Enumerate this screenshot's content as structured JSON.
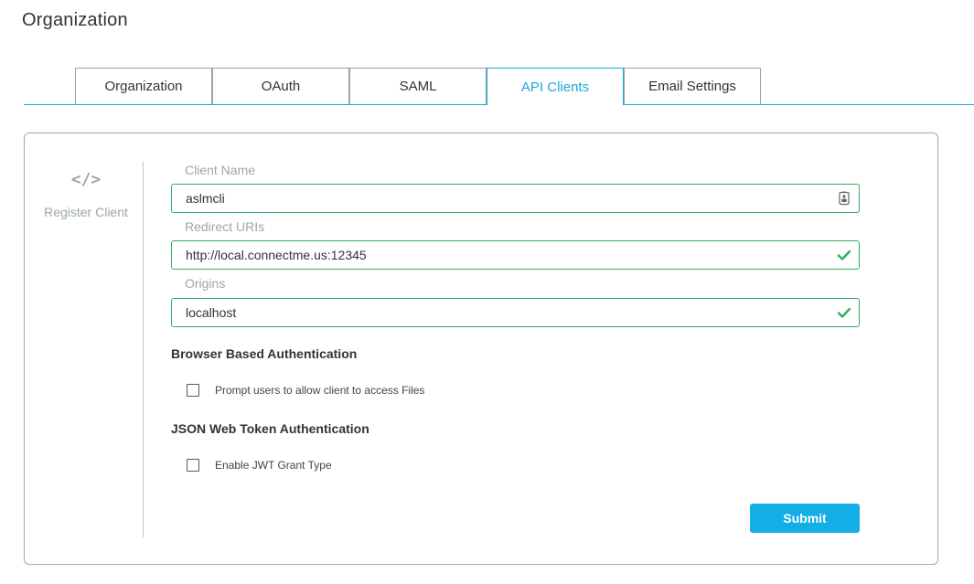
{
  "page": {
    "title": "Organization"
  },
  "tabs": [
    {
      "label": "Organization",
      "active": false
    },
    {
      "label": "OAuth",
      "active": false
    },
    {
      "label": "SAML",
      "active": false
    },
    {
      "label": "API Clients",
      "active": true
    },
    {
      "label": "Email Settings",
      "active": false
    }
  ],
  "sidebar": {
    "icon_glyph": "</>",
    "icon_name": "code-icon",
    "label": "Register Client"
  },
  "form": {
    "client_name": {
      "label": "Client Name",
      "value": "aslmcli",
      "icon": "contact-card-icon"
    },
    "redirect_uris": {
      "label": "Redirect URIs",
      "value": "http://local.connectme.us:12345",
      "icon": "checkmark-icon"
    },
    "origins": {
      "label": "Origins",
      "value": "localhost",
      "icon": "checkmark-icon"
    },
    "browser_auth": {
      "heading": "Browser Based Authentication",
      "checkbox_label": "Prompt users to allow client to access Files",
      "checked": false
    },
    "jwt_auth": {
      "heading": "JSON Web Token Authentication",
      "checkbox_label": "Enable JWT Grant Type",
      "checked": false
    },
    "submit_label": "Submit"
  },
  "colors": {
    "accent": "#1aa7d8",
    "valid": "#2eaf5c",
    "button": "#14aee6",
    "muted_text": "#9aa6ad"
  }
}
